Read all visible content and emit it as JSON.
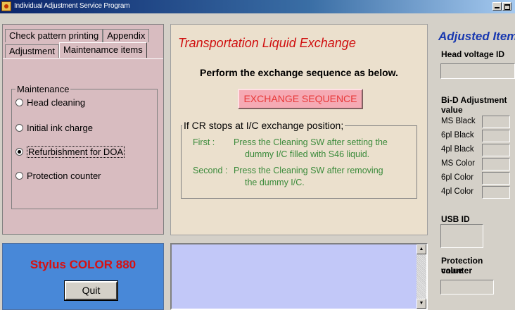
{
  "window": {
    "title": "Individual Adjustment Service Program"
  },
  "tabs": {
    "row1": [
      "Check pattern printing",
      "Appendix"
    ],
    "row2": [
      "Adjustment",
      "Maintenamce items"
    ]
  },
  "maintenance": {
    "legend": "Maintenance",
    "options": [
      "Head cleaning",
      "Initial ink charge",
      "Refurbishment for DOA",
      "Protection counter"
    ],
    "selected": "Refurbishment for DOA"
  },
  "center": {
    "title": "Transportation Liquid Exchange",
    "instruction": "Perform the exchange sequence as below.",
    "button": "EXCHANGE SEQUENCE",
    "cr_legend": "If CR stops at I/C exchange position;",
    "first_label": "First :",
    "first_line1": "Press the Cleaning SW after setting the",
    "first_line2": "dummy I/C filled with S46 liquid.",
    "second_label": "Second :",
    "second_line1": "Press the Cleaning SW after removing",
    "second_line2": "the dummy I/C."
  },
  "model": {
    "name": "Stylus COLOR 880",
    "quit": "Quit"
  },
  "right": {
    "title": "Adjusted Item",
    "head_voltage_label": "Head voltage ID",
    "bid_label_1": "Bi-D Adjustment",
    "bid_label_2": "value",
    "bid_rows": [
      "MS Black",
      "6pl Black",
      "4pl Black",
      "MS Color",
      "6pl Color",
      "4pl Color"
    ],
    "usb_label": "USB ID",
    "protection_label_1": "Protection counter",
    "protection_label_2": "value"
  },
  "colors": {
    "title_red": "#d01010",
    "accent_blue": "#1838b0",
    "step_green": "#3a8a3a"
  }
}
